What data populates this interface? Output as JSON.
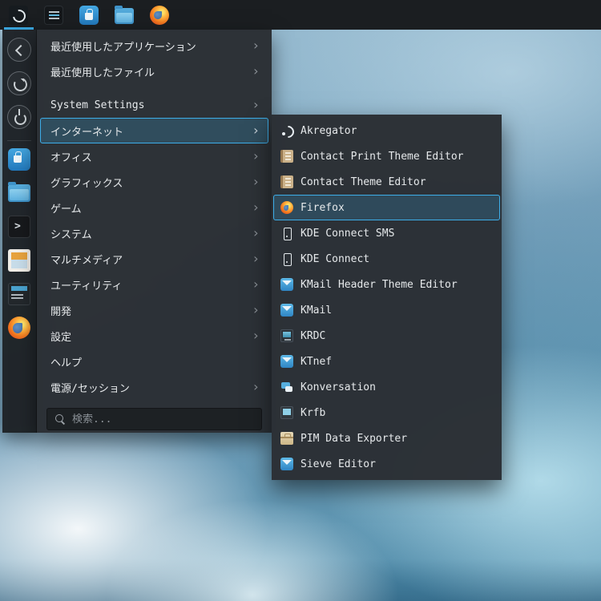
{
  "colors": {
    "accent": "#3daee9",
    "panel_bg": "#1b1e21",
    "menu_bg": "#2b2f34"
  },
  "icons": {
    "chevron": "›"
  },
  "panel": {
    "items": [
      {
        "name": "application-launcher",
        "selected": true
      },
      {
        "name": "system-monitor"
      },
      {
        "name": "discover"
      },
      {
        "name": "dolphin-file-manager"
      },
      {
        "name": "firefox"
      }
    ]
  },
  "sidebar": {
    "nav_buttons": [
      {
        "name": "back"
      },
      {
        "name": "refresh"
      },
      {
        "name": "power"
      }
    ],
    "favorites": [
      {
        "name": "discover"
      },
      {
        "name": "dolphin-file-manager"
      },
      {
        "name": "konsole"
      },
      {
        "name": "kontact"
      },
      {
        "name": "system-monitor"
      },
      {
        "name": "firefox"
      }
    ]
  },
  "menu": {
    "items": [
      {
        "label": "最近使用したアプリケーション",
        "has_submenu": true
      },
      {
        "label": "最近使用したファイル",
        "has_submenu": true
      },
      {
        "label": "System Settings",
        "has_submenu": true
      },
      {
        "label": "インターネット",
        "has_submenu": true,
        "selected": true
      },
      {
        "label": "オフィス",
        "has_submenu": true
      },
      {
        "label": "グラフィックス",
        "has_submenu": true
      },
      {
        "label": "ゲーム",
        "has_submenu": true
      },
      {
        "label": "システム",
        "has_submenu": true
      },
      {
        "label": "マルチメディア",
        "has_submenu": true
      },
      {
        "label": "ユーティリティ",
        "has_submenu": true
      },
      {
        "label": "開発",
        "has_submenu": true
      },
      {
        "label": "設定",
        "has_submenu": true
      },
      {
        "label": "ヘルプ",
        "has_submenu": false
      },
      {
        "label": "電源/セッション",
        "has_submenu": true
      }
    ],
    "search_placeholder": "検索..."
  },
  "submenu": {
    "items": [
      {
        "label": "Akregator",
        "icon": "akregator-feed"
      },
      {
        "label": "Contact Print Theme Editor",
        "icon": "contact-print-theme-editor"
      },
      {
        "label": "Contact Theme Editor",
        "icon": "contact-theme-editor"
      },
      {
        "label": "Firefox",
        "icon": "firefox",
        "selected": true
      },
      {
        "label": "KDE Connect SMS",
        "icon": "kde-connect-sms"
      },
      {
        "label": "KDE Connect",
        "icon": "kde-connect"
      },
      {
        "label": "KMail Header Theme Editor",
        "icon": "kmail"
      },
      {
        "label": "KMail",
        "icon": "kmail"
      },
      {
        "label": "KRDC",
        "icon": "krdc"
      },
      {
        "label": "KTnef",
        "icon": "ktnef"
      },
      {
        "label": "Konversation",
        "icon": "konversation"
      },
      {
        "label": "Krfb",
        "icon": "krfb"
      },
      {
        "label": "PIM Data Exporter",
        "icon": "pim-data-exporter"
      },
      {
        "label": "Sieve Editor",
        "icon": "sieve-editor"
      }
    ]
  }
}
